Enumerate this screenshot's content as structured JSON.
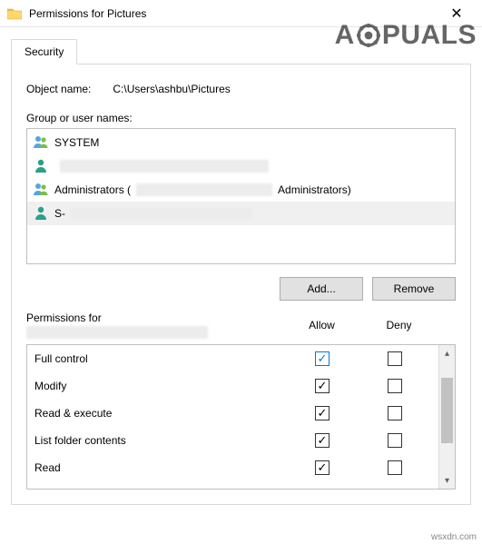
{
  "window": {
    "title": "Permissions for Pictures"
  },
  "watermark": {
    "prefix": "A",
    "suffix": "PUALS"
  },
  "tabs": {
    "security": "Security"
  },
  "object": {
    "label": "Object name:",
    "value": "C:\\Users\\ashbu\\Pictures"
  },
  "groups": {
    "label": "Group or user names:",
    "items": [
      {
        "name": "SYSTEM",
        "type": "group",
        "redact_after": false
      },
      {
        "name": "",
        "type": "user",
        "redact_after": true
      },
      {
        "name_prefix": "Administrators (",
        "name_suffix": "Administrators)",
        "type": "group",
        "redact_mid": true
      },
      {
        "name": "S-",
        "type": "user",
        "redact_after": true,
        "selected": true
      }
    ]
  },
  "buttons": {
    "add": "Add...",
    "remove": "Remove"
  },
  "permissions": {
    "label": "Permissions for",
    "allow": "Allow",
    "deny": "Deny",
    "rows": [
      {
        "name": "Full control",
        "allow": true,
        "deny": false,
        "focus": true
      },
      {
        "name": "Modify",
        "allow": true,
        "deny": false
      },
      {
        "name": "Read & execute",
        "allow": true,
        "deny": false
      },
      {
        "name": "List folder contents",
        "allow": true,
        "deny": false
      },
      {
        "name": "Read",
        "allow": true,
        "deny": false
      }
    ]
  },
  "footer": {
    "source": "wsxdn.com"
  }
}
